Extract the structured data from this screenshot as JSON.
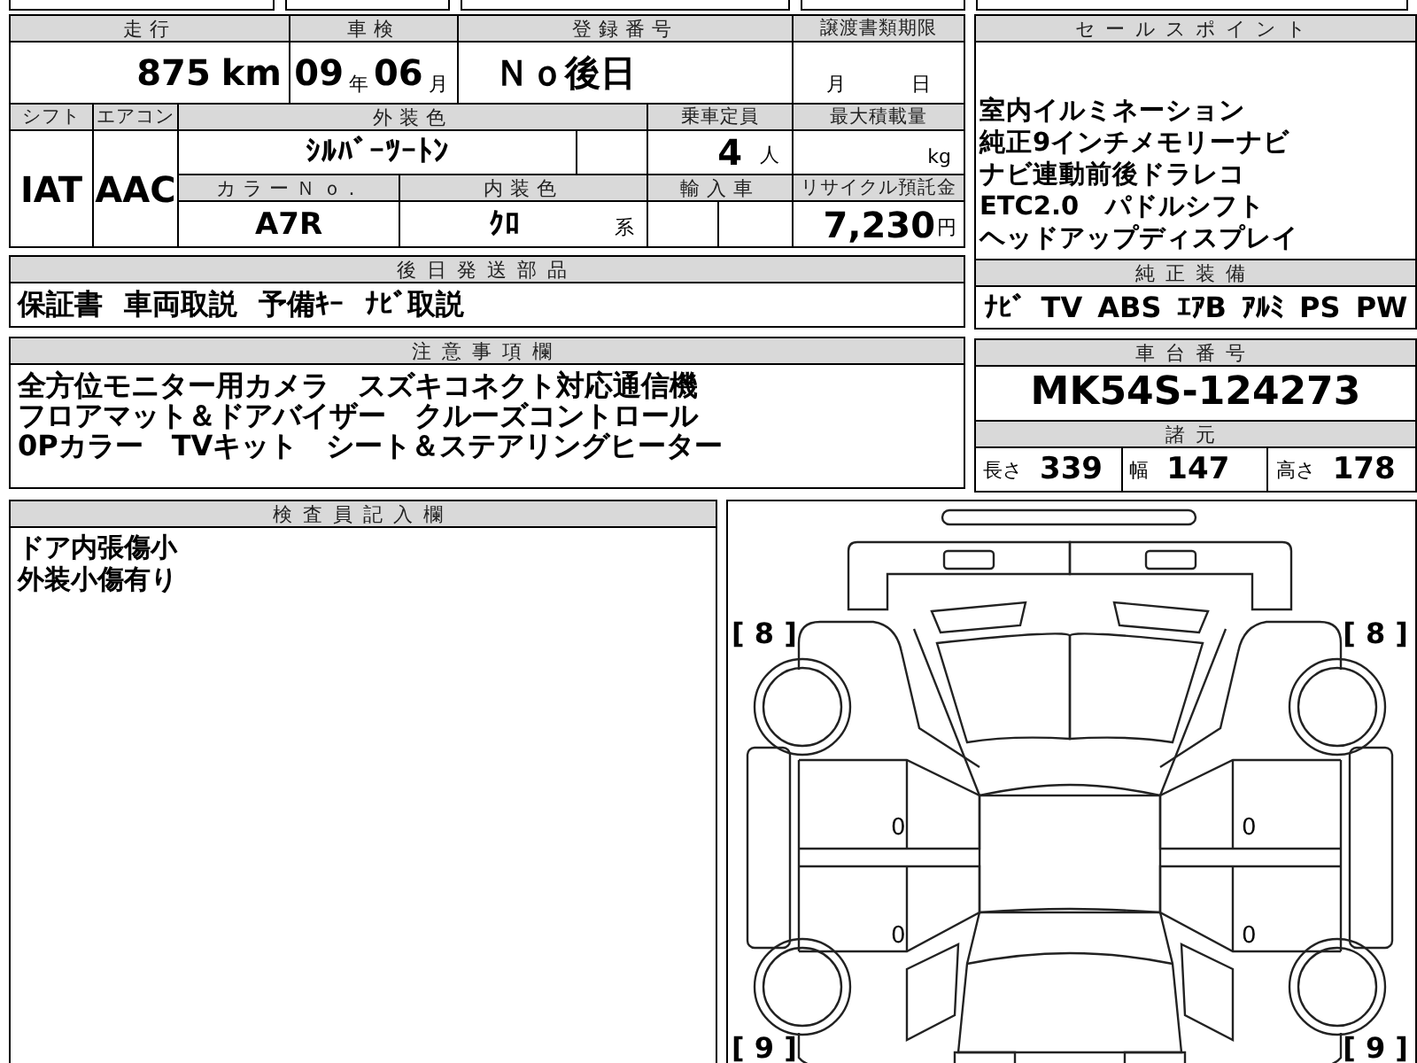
{
  "top_table": {
    "mileage": {
      "label": "走行",
      "value": "875",
      "unit": "km"
    },
    "inspection": {
      "label": "車検",
      "year": "09",
      "year_unit": "年",
      "month": "06",
      "month_unit": "月"
    },
    "registration": {
      "label": "登録番号",
      "value": "Ｎｏ後日"
    },
    "transfer_deadline": {
      "label": "譲渡書類期限",
      "month_unit": "月",
      "day_unit": "日"
    },
    "shift": {
      "label": "シフト",
      "value": "IAT"
    },
    "aircon": {
      "label": "エアコン",
      "value": "AAC"
    },
    "exterior_color": {
      "label": "外装色",
      "value": "ｼﾙﾊﾞｰﾂｰﾄﾝ"
    },
    "capacity": {
      "label": "乗車定員",
      "value": "4",
      "unit": "人"
    },
    "max_load": {
      "label": "最大積載量",
      "unit": "kg"
    },
    "color_no": {
      "label": "カラーＮｏ.",
      "value": "A7R"
    },
    "interior_color": {
      "label": "内装色",
      "value": "ｸﾛ",
      "unit": "系"
    },
    "import": {
      "label": "輸入車"
    },
    "recycle_fee": {
      "label": "リサイクル預託金",
      "value": "7,230",
      "unit": "円"
    }
  },
  "later_parts": {
    "title": "後日発送部品",
    "items": [
      "保証書",
      "車両取説",
      "予備ｷｰ",
      "ﾅﾋﾞ取説"
    ]
  },
  "notes": {
    "title": "注意事項欄",
    "lines": [
      "全方位モニター用カメラ　スズキコネクト対応通信機",
      "フロアマット＆ドアバイザー　クルーズコントロール",
      "0Pカラー　TVキット　シート＆ステアリングヒーター"
    ]
  },
  "sales_points": {
    "title": "セールスポイント",
    "lines": [
      "室内イルミネーション",
      "純正9インチメモリーナビ",
      "ナビ連動前後ドラレコ",
      "ETC2.0　パドルシフト",
      "ヘッドアップディスプレイ"
    ]
  },
  "standard_equipment": {
    "title": "純正装備",
    "items": [
      "ﾅﾋﾞ",
      "TV",
      "ABS",
      "ｴｱB",
      "ｱﾙﾐ",
      "PS",
      "PW"
    ]
  },
  "chassis": {
    "title": "車台番号",
    "value": "MK54S-124273"
  },
  "specs": {
    "title": "諸元",
    "items": [
      {
        "label": "長さ",
        "value": "339"
      },
      {
        "label": "幅",
        "value": "147"
      },
      {
        "label": "高さ",
        "value": "178"
      }
    ]
  },
  "inspector": {
    "title": "検査員記入欄",
    "lines": [
      "ドア内張傷小",
      "外装小傷有り"
    ]
  },
  "diagram": {
    "corner_marks": [
      "[ 8 ]",
      "[ 8 ]",
      "[ 9 ]",
      "[ 9 ]"
    ],
    "panel_marks": [
      "0",
      "0",
      "0",
      "0"
    ]
  }
}
